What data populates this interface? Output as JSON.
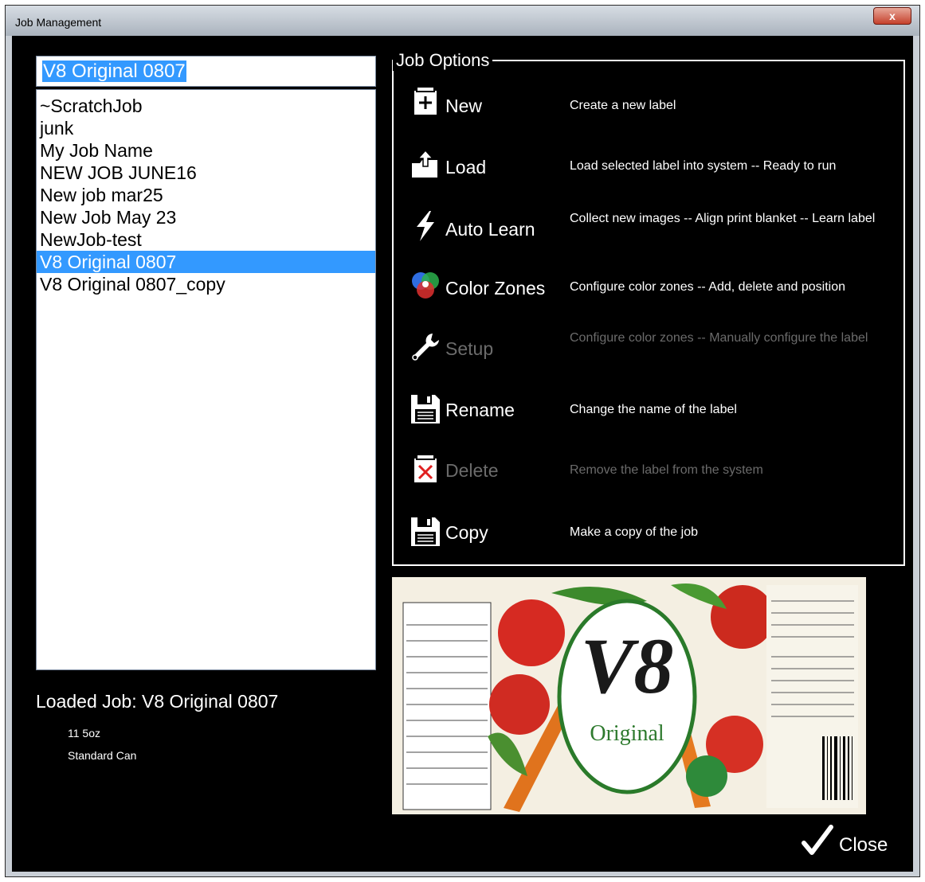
{
  "window": {
    "title": "Job Management",
    "close_glyph": "x"
  },
  "search": {
    "value": "V8 Original 0807"
  },
  "jobs": {
    "items": [
      "~ScratchJob",
      "junk",
      "My Job Name",
      "NEW JOB JUNE16",
      "New job mar25",
      "New Job May 23",
      "NewJob-test",
      "V8 Original 0807",
      "V8 Original 0807_copy"
    ],
    "selected": "V8 Original 0807"
  },
  "loaded_job": {
    "label": "Loaded Job: V8 Original 0807",
    "details": [
      "11 5oz",
      "Standard Can"
    ]
  },
  "job_options": {
    "title": "Job Options",
    "options": [
      {
        "label": "New",
        "description": "Create a new label",
        "icon": "new-document-icon",
        "enabled": true
      },
      {
        "label": "Load",
        "description": "Load selected label into system -- Ready to run",
        "icon": "load-folder-icon",
        "enabled": true
      },
      {
        "label": "Auto Learn",
        "description": "Collect new images -- Align print blanket -- Learn label",
        "icon": "lightning-bolt-icon",
        "enabled": true
      },
      {
        "label": "Color Zones",
        "description": "Configure color zones -- Add, delete and position",
        "icon": "color-circles-icon",
        "enabled": true
      },
      {
        "label": "Setup",
        "description": "Configure color zones -- Manually configure the label",
        "icon": "wrench-icon",
        "enabled": false
      },
      {
        "label": "Rename",
        "description": "Change the name of the label",
        "icon": "floppy-disk-icon",
        "enabled": true
      },
      {
        "label": "Delete",
        "description": "Remove the label from the system",
        "icon": "delete-document-icon",
        "enabled": false
      },
      {
        "label": "Copy",
        "description": "Make a copy of the job",
        "icon": "floppy-disk-icon",
        "enabled": true
      }
    ]
  },
  "label_image": {
    "brand": "V8",
    "variant": "Original"
  },
  "close_button": {
    "label": "Close",
    "icon": "checkmark-icon"
  },
  "colors": {
    "selection": "#3399ff",
    "background": "#000000",
    "disabled_text": "#6b6b6b"
  }
}
